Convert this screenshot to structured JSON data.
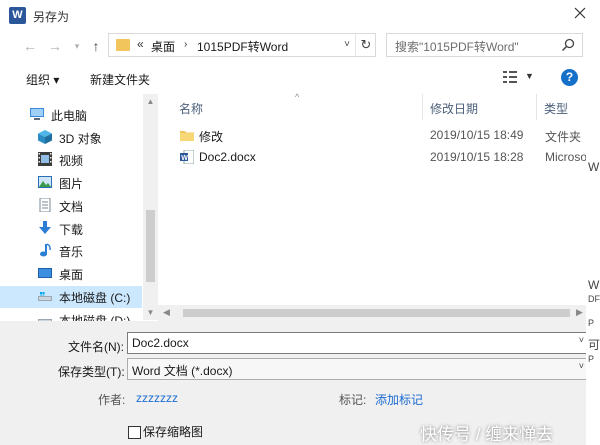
{
  "window": {
    "title": "另存为",
    "app_icon_letter": "W"
  },
  "address": {
    "root_chevron": "«",
    "path": [
      "桌面",
      "1015PDF转Word"
    ]
  },
  "search": {
    "placeholder": "搜索\"1015PDF转Word\""
  },
  "toolbar": {
    "organize": "组织 ▾",
    "new_folder": "新建文件夹"
  },
  "nav": {
    "items": [
      {
        "label": "此电脑",
        "icon": "computer-icon"
      },
      {
        "label": "3D 对象",
        "icon": "3d-objects-icon"
      },
      {
        "label": "视频",
        "icon": "video-icon"
      },
      {
        "label": "图片",
        "icon": "pictures-icon"
      },
      {
        "label": "文档",
        "icon": "documents-icon"
      },
      {
        "label": "下载",
        "icon": "download-icon"
      },
      {
        "label": "音乐",
        "icon": "music-icon"
      },
      {
        "label": "桌面",
        "icon": "desktop-icon"
      },
      {
        "label": "本地磁盘 (C:)",
        "icon": "drive-icon"
      },
      {
        "label": "本地磁盘 (D:)",
        "icon": "drive-icon"
      }
    ]
  },
  "files": {
    "columns": {
      "name": "名称",
      "date": "修改日期",
      "type": "类型"
    },
    "rows": [
      {
        "name": "修改",
        "date": "2019/10/15 18:49",
        "type": "文件夹",
        "icon": "folder-icon"
      },
      {
        "name": "Doc2.docx",
        "date": "2019/10/15 18:28",
        "type": "Microso",
        "icon": "word-doc-icon"
      }
    ]
  },
  "form": {
    "filename_label": "文件名(N):",
    "filename_value": "Doc2.docx",
    "savetype_label": "保存类型(T):",
    "savetype_value": "Word 文档 (*.docx)",
    "author_label": "作者:",
    "author_value": "zzzzzzz",
    "tags_label": "标记:",
    "tags_value": "添加标记",
    "thumbnail_label": "保存缩略图"
  },
  "background_fragments": [
    "W",
    "W",
    "DF",
    "P",
    "可",
    "P"
  ],
  "watermark": "快传号 / 缠来惮去",
  "colors": {
    "accent": "#1570c9",
    "selection": "#cce8ff",
    "link": "#1a6bd1",
    "folder": "#f2c55c"
  }
}
